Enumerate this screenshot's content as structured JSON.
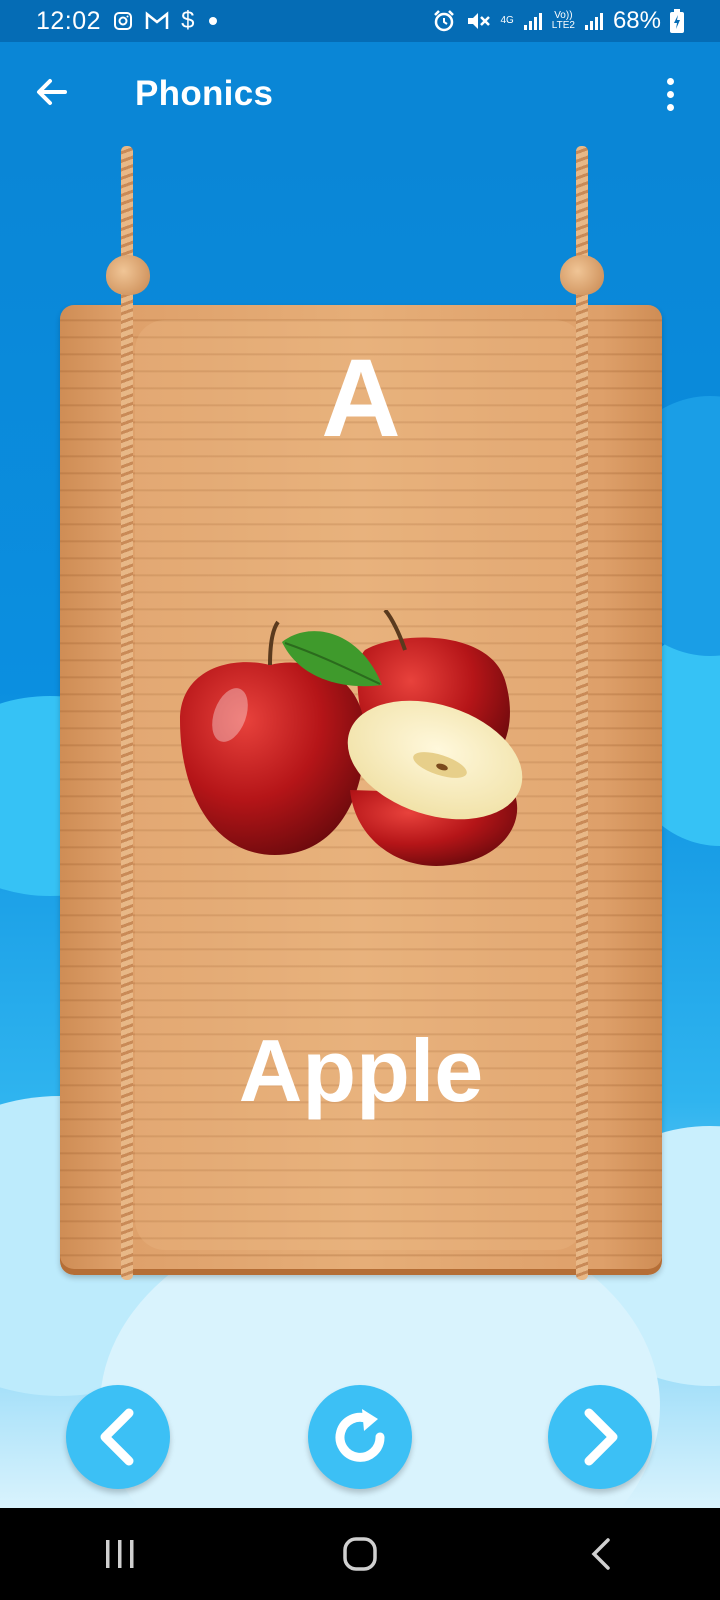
{
  "status_bar": {
    "time": "12:02",
    "left_icons": [
      "instagram-icon",
      "gmail-icon",
      "dollar-icon",
      "dot-icon"
    ],
    "dollar_glyph": "$",
    "network_4g": "4G",
    "volte_top": "Vo))",
    "volte_bottom": "LTE2",
    "battery": "68%"
  },
  "app_bar": {
    "title": "Phonics"
  },
  "card": {
    "letter": "A",
    "word": "Apple",
    "image_icon": "apple-icon"
  },
  "controls": {
    "previous": "chevron-left-icon",
    "replay": "replay-icon",
    "next": "chevron-right-icon"
  },
  "colors": {
    "status_bar": "#056cb5",
    "app_bar": "#0a86d6",
    "button": "#3cc0f5",
    "wood": "#e6ae78"
  }
}
